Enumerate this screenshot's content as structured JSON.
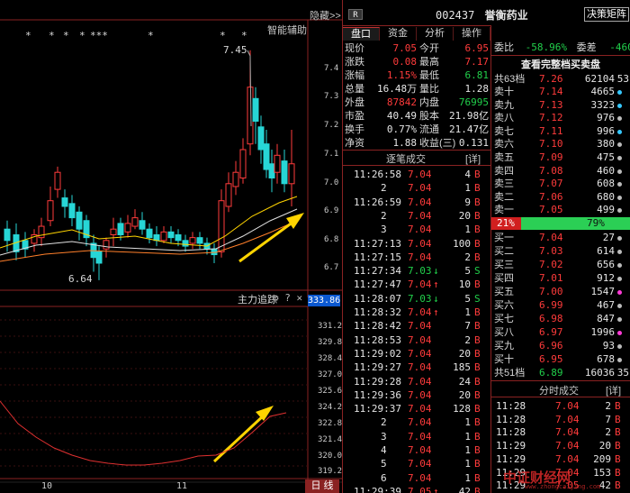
{
  "left": {
    "hide_label": "隐藏>>",
    "assist_label": "智能辅助",
    "asterisks": [
      "*",
      "*",
      "*",
      "*",
      "***",
      "*",
      "*",
      "*"
    ],
    "price_ticks": [
      "7.4",
      "7.3",
      "7.2",
      "7.1",
      "7.0",
      "6.9",
      "6.8",
      "6.7"
    ],
    "high_label": "7.45",
    "low_label": "6.64",
    "indicator_title": "主力追踪",
    "indicator_value": "333.86",
    "indicator_ticks": [
      "331.2",
      "329.8",
      "328.4",
      "327.0",
      "325.6",
      "324.2",
      "322.8",
      "321.4",
      "320.0",
      "319.2"
    ],
    "date_labels": [
      "10",
      "11"
    ],
    "period_label": "日 线"
  },
  "header": {
    "badge": "R",
    "code": "002437",
    "name": "誉衡药业",
    "decision_button": "决策矩阵"
  },
  "tabs": [
    "盘口",
    "资金",
    "分析",
    "操作"
  ],
  "quote": {
    "rows": [
      {
        "l1": "现价",
        "v1": "7.05",
        "l2": "今开",
        "v2": "6.95"
      },
      {
        "l1": "涨跌",
        "v1": "0.08",
        "l2": "最高",
        "v2": "7.17"
      },
      {
        "l1": "涨幅",
        "v1": "1.15%",
        "l2": "最低",
        "v2": "6.81"
      },
      {
        "l1": "总量",
        "v1": "16.48万",
        "l2": "量比",
        "v2": "1.28"
      },
      {
        "l1": "外盘",
        "v1": "87842",
        "l2": "内盘",
        "v2": "76995"
      },
      {
        "l1": "市盈",
        "v1": "40.49",
        "l2": "股本",
        "v2": "21.98亿"
      },
      {
        "l1": "换手",
        "v1": "0.77%",
        "l2": "流通",
        "v2": "21.47亿"
      },
      {
        "l1": "净资",
        "v1": "1.88",
        "l2": "收益(三)",
        "v2": "0.131"
      }
    ]
  },
  "ticks": {
    "title": "逐笔成交",
    "detail": "[详]",
    "rows": [
      {
        "t": "11:26:58",
        "p": "7.04",
        "a": "",
        "v": "4",
        "s": "B"
      },
      {
        "t": "2",
        "p": "7.04",
        "a": "",
        "v": "1",
        "s": "B"
      },
      {
        "t": "11:26:59",
        "p": "7.04",
        "a": "",
        "v": "9",
        "s": "B"
      },
      {
        "t": "2",
        "p": "7.04",
        "a": "",
        "v": "20",
        "s": "B"
      },
      {
        "t": "3",
        "p": "7.04",
        "a": "",
        "v": "1",
        "s": "B"
      },
      {
        "t": "11:27:13",
        "p": "7.04",
        "a": "",
        "v": "100",
        "s": "B"
      },
      {
        "t": "11:27:15",
        "p": "7.04",
        "a": "",
        "v": "2",
        "s": "B"
      },
      {
        "t": "11:27:34",
        "p": "7.03",
        "a": "↓",
        "v": "5",
        "s": "S"
      },
      {
        "t": "11:27:47",
        "p": "7.04",
        "a": "↑",
        "v": "10",
        "s": "B"
      },
      {
        "t": "11:28:07",
        "p": "7.03",
        "a": "↓",
        "v": "5",
        "s": "S"
      },
      {
        "t": "11:28:32",
        "p": "7.04",
        "a": "↑",
        "v": "1",
        "s": "B"
      },
      {
        "t": "11:28:42",
        "p": "7.04",
        "a": "",
        "v": "7",
        "s": "B"
      },
      {
        "t": "11:28:53",
        "p": "7.04",
        "a": "",
        "v": "2",
        "s": "B"
      },
      {
        "t": "11:29:02",
        "p": "7.04",
        "a": "",
        "v": "20",
        "s": "B"
      },
      {
        "t": "11:29:27",
        "p": "7.04",
        "a": "",
        "v": "185",
        "s": "B"
      },
      {
        "t": "11:29:28",
        "p": "7.04",
        "a": "",
        "v": "24",
        "s": "B"
      },
      {
        "t": "11:29:36",
        "p": "7.04",
        "a": "",
        "v": "20",
        "s": "B"
      },
      {
        "t": "11:29:37",
        "p": "7.04",
        "a": "",
        "v": "128",
        "s": "B"
      },
      {
        "t": "2",
        "p": "7.04",
        "a": "",
        "v": "1",
        "s": "B"
      },
      {
        "t": "3",
        "p": "7.04",
        "a": "",
        "v": "1",
        "s": "B"
      },
      {
        "t": "4",
        "p": "7.04",
        "a": "",
        "v": "1",
        "s": "B"
      },
      {
        "t": "5",
        "p": "7.04",
        "a": "",
        "v": "1",
        "s": "B"
      },
      {
        "t": "6",
        "p": "7.04",
        "a": "",
        "v": "1",
        "s": "B"
      },
      {
        "t": "11:29:39",
        "p": "7.05",
        "a": "↑",
        "v": "42",
        "s": "B"
      }
    ]
  },
  "book": {
    "ratio_label": "委比",
    "ratio_value": "-58.96%",
    "diff_label": "委差",
    "diff_value": "-46068",
    "full_link": "查看完整档买卖盘",
    "sell_total": {
      "l": "共63档",
      "p": "7.26",
      "v": "62104",
      "n": "53"
    },
    "sells": [
      {
        "l": "卖十",
        "p": "7.14",
        "v": "4665",
        "d": "cyan"
      },
      {
        "l": "卖九",
        "p": "7.13",
        "v": "3323",
        "d": "cyan"
      },
      {
        "l": "卖八",
        "p": "7.12",
        "v": "976",
        "d": "white"
      },
      {
        "l": "卖七",
        "p": "7.11",
        "v": "996",
        "d": "cyan"
      },
      {
        "l": "卖六",
        "p": "7.10",
        "v": "380",
        "d": "white"
      },
      {
        "l": "卖五",
        "p": "7.09",
        "v": "475",
        "d": "white"
      },
      {
        "l": "卖四",
        "p": "7.08",
        "v": "460",
        "d": "white"
      },
      {
        "l": "卖三",
        "p": "7.07",
        "v": "608",
        "d": "white"
      },
      {
        "l": "卖二",
        "p": "7.06",
        "v": "680",
        "d": "white"
      },
      {
        "l": "卖一",
        "p": "7.05",
        "v": "499",
        "d": "white"
      }
    ],
    "buy_pct": "21%",
    "sell_pct": "79%",
    "buy_pct_value": 21,
    "buys": [
      {
        "l": "买一",
        "p": "7.04",
        "v": "27",
        "d": "white"
      },
      {
        "l": "买二",
        "p": "7.03",
        "v": "614",
        "d": "white"
      },
      {
        "l": "买三",
        "p": "7.02",
        "v": "656",
        "d": "white"
      },
      {
        "l": "买四",
        "p": "7.01",
        "v": "912",
        "d": "white"
      },
      {
        "l": "买五",
        "p": "7.00",
        "v": "1547",
        "d": "magenta"
      },
      {
        "l": "买六",
        "p": "6.99",
        "v": "467",
        "d": "white"
      },
      {
        "l": "买七",
        "p": "6.98",
        "v": "847",
        "d": "white"
      },
      {
        "l": "买八",
        "p": "6.97",
        "v": "1996",
        "d": "magenta"
      },
      {
        "l": "买九",
        "p": "6.96",
        "v": "93",
        "d": "white"
      },
      {
        "l": "买十",
        "p": "6.95",
        "v": "678",
        "d": "white"
      }
    ],
    "buy_total": {
      "l": "共51档",
      "p": "6.89",
      "v": "16036",
      "n": "35"
    }
  },
  "minute": {
    "title": "分时成交",
    "detail": "[详]",
    "rows": [
      {
        "t": "11:28",
        "p": "7.04",
        "v": "2",
        "s": "B"
      },
      {
        "t": "11:28",
        "p": "7.04",
        "v": "7",
        "s": "B"
      },
      {
        "t": "11:28",
        "p": "7.04",
        "v": "2",
        "s": "B"
      },
      {
        "t": "11:29",
        "p": "7.04",
        "v": "20",
        "s": "B"
      },
      {
        "t": "11:29",
        "p": "7.04",
        "v": "209",
        "s": "B"
      },
      {
        "t": "11:29",
        "p": "7.04",
        "v": "153",
        "s": "B"
      },
      {
        "t": "11:29",
        "p": "7.05",
        "v": "42",
        "s": "B"
      }
    ]
  },
  "watermark": "中证财经网",
  "watermark_url": "www.zhongcaijing.com",
  "colors": {
    "up": "#ff3b3b",
    "down": "#21d04b",
    "accent": "#8a2222",
    "candle_down": "#27d6d6"
  }
}
